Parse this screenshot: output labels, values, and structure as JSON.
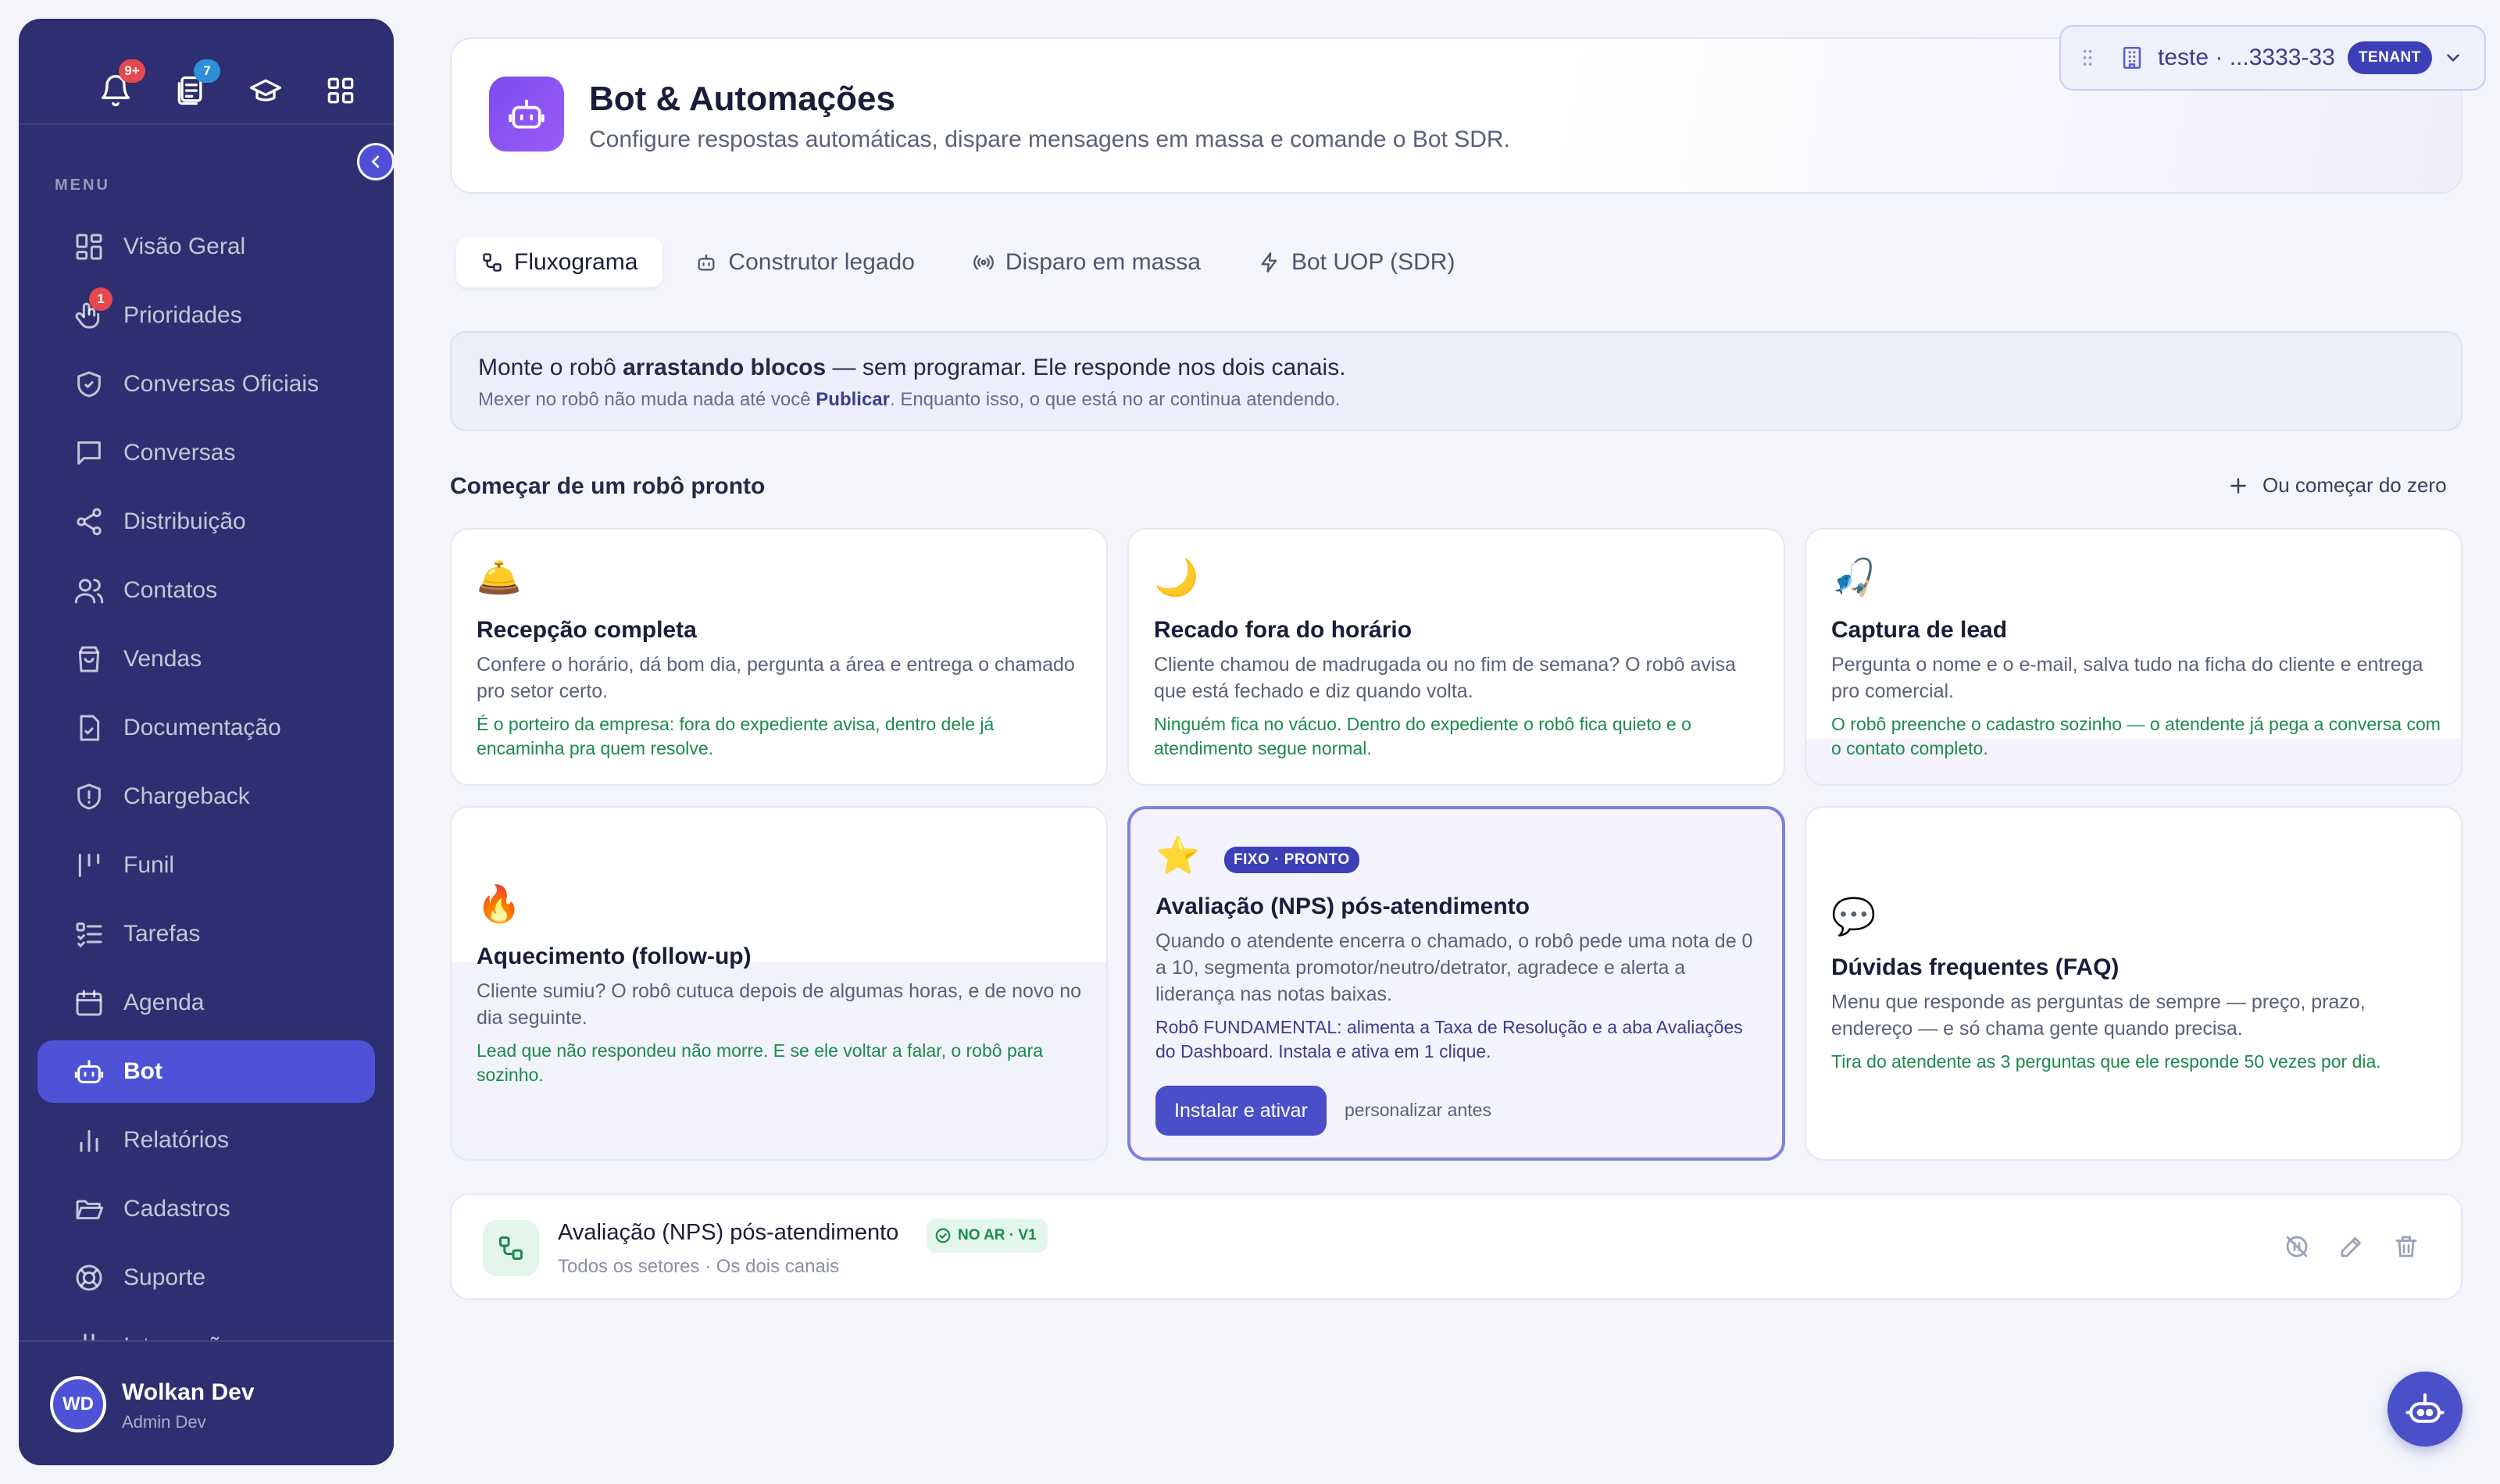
{
  "sidebar": {
    "top_icons": [
      {
        "icon": "bell-icon",
        "badge": "9+",
        "badge_color": "#e5484d"
      },
      {
        "icon": "document-stack-icon",
        "badge": "7",
        "badge_color": "#2f8fd8"
      },
      {
        "icon": "graduation-cap-icon",
        "badge": null
      },
      {
        "icon": "apps-grid-icon",
        "badge": null
      }
    ],
    "menu_label": "MENU",
    "items": [
      {
        "label": "Visão Geral",
        "icon": "dashboard-icon"
      },
      {
        "label": "Prioridades",
        "icon": "priority-hand-icon",
        "badge": "1"
      },
      {
        "label": "Conversas Oficiais",
        "icon": "shield-check-icon"
      },
      {
        "label": "Conversas",
        "icon": "chat-bubble-icon"
      },
      {
        "label": "Distribuição",
        "icon": "share-nodes-icon"
      },
      {
        "label": "Contatos",
        "icon": "users-icon"
      },
      {
        "label": "Vendas",
        "icon": "shopping-bag-icon"
      },
      {
        "label": "Documentação",
        "icon": "file-check-icon"
      },
      {
        "label": "Chargeback",
        "icon": "shield-alert-icon"
      },
      {
        "label": "Funil",
        "icon": "funnel-bars-icon"
      },
      {
        "label": "Tarefas",
        "icon": "task-list-icon"
      },
      {
        "label": "Agenda",
        "icon": "calendar-icon"
      },
      {
        "label": "Bot",
        "icon": "bot-icon",
        "active": true
      },
      {
        "label": "Relatórios",
        "icon": "bar-chart-icon"
      },
      {
        "label": "Cadastros",
        "icon": "folder-open-icon"
      },
      {
        "label": "Suporte",
        "icon": "lifebuoy-icon"
      },
      {
        "label": "Integrações",
        "icon": "plug-icon"
      }
    ],
    "user": {
      "initials": "WD",
      "name": "Wolkan Dev",
      "role": "Admin Dev"
    }
  },
  "header": {
    "title": "Bot & Automações",
    "subtitle": "Configure respostas automáticas, dispare mensagens em massa e comande o Bot SDR."
  },
  "tenant": {
    "label": "teste · ...3333-33",
    "badge": "TENANT"
  },
  "tabs": [
    {
      "label": "Fluxograma",
      "icon": "flow-icon",
      "active": true
    },
    {
      "label": "Construtor legado",
      "icon": "bot-icon"
    },
    {
      "label": "Disparo em massa",
      "icon": "broadcast-icon"
    },
    {
      "label": "Bot UOP (SDR)",
      "icon": "lightning-icon"
    }
  ],
  "info": {
    "line1_pre": "Monte o robô ",
    "line1_bold": "arrastando blocos",
    "line1_post": " — sem programar. Ele responde nos dois canais.",
    "line2_pre": "Mexer no robô não muda nada até você ",
    "line2_bold": "Publicar",
    "line2_post": ". Enquanto isso, o que está no ar continua atendendo."
  },
  "templates_section": {
    "title": "Começar de um robô pronto",
    "from_zero": "Ou começar do zero"
  },
  "templates": [
    {
      "emoji": "🛎️",
      "title": "Recepção completa",
      "description": "Confere o horário, dá bom dia, pergunta a área e entrega o chamado pro setor certo.",
      "hint": "É o porteiro da empresa: fora do expediente avisa, dentro dele já encaminha pra quem resolve."
    },
    {
      "emoji": "🌙",
      "title": "Recado fora do horário",
      "description": "Cliente chamou de madrugada ou no fim de semana? O robô avisa que está fechado e diz quando volta.",
      "hint": "Ninguém fica no vácuo. Dentro do expediente o robô fica quieto e o atendimento segue normal."
    },
    {
      "emoji": "🎣",
      "title": "Captura de lead",
      "description": "Pergunta o nome e o e-mail, salva tudo na ficha do cliente e entrega pro comercial.",
      "hint": "O robô preenche o cadastro sozinho — o atendente já pega a conversa com o contato completo."
    },
    {
      "emoji": "🔥",
      "title": "Aquecimento (follow-up)",
      "description": "Cliente sumiu? O robô cutuca depois de algumas horas, e de novo no dia seguinte.",
      "hint": "Lead que não respondeu não morre. E se ele voltar a falar, o robô para sozinho."
    },
    {
      "emoji": "⭐",
      "badge": "FIXO · PRONTO",
      "title": "Avaliação (NPS) pós-atendimento",
      "description": "Quando o atendente encerra o chamado, o robô pede uma nota de 0 a 10, segmenta promotor/neutro/detrator, agradece e alerta a liderança nas notas baixas.",
      "hint": "Robô FUNDAMENTAL: alimenta a Taxa de Resolução e a aba Avaliações do Dashboard. Instala e ativa em 1 clique.",
      "install_label": "Instalar e ativar",
      "customize_label": "personalizar antes"
    },
    {
      "emoji": "💬",
      "title": "Dúvidas frequentes (FAQ)",
      "description": "Menu que responde as perguntas de sempre — preço, prazo, endereço — e só chama gente quando precisa.",
      "hint": "Tira do atendente as 3 perguntas que ele responde 50 vezes por dia."
    }
  ],
  "bots": [
    {
      "name": "Avaliação (NPS) pós-atendimento",
      "status": "NO AR · V1",
      "subtitle": "Todos os setores · Os dois canais",
      "actions": [
        "pause-icon",
        "edit-icon",
        "trash-icon"
      ]
    }
  ],
  "colors": {
    "sidebar": "#2e2f70",
    "accent": "#4e52d6",
    "success": "#1b8a4c"
  }
}
